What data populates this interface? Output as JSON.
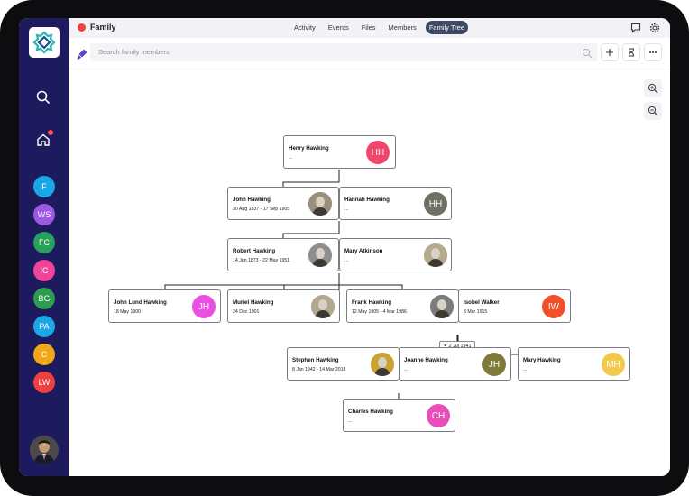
{
  "app": {
    "title": "Family",
    "accent": "#f2423f"
  },
  "nav_tabs": [
    {
      "label": "Activity",
      "active": false
    },
    {
      "label": "Events",
      "active": false
    },
    {
      "label": "Files",
      "active": false
    },
    {
      "label": "Members",
      "active": false
    },
    {
      "label": "Family Tree",
      "active": true
    }
  ],
  "search": {
    "placeholder": "Search family members"
  },
  "rail": {
    "spaces": [
      {
        "label": "F",
        "color": "#1aa7e8"
      },
      {
        "label": "WS",
        "color": "#9b59e6"
      },
      {
        "label": "FC",
        "color": "#27a05c"
      },
      {
        "label": "IC",
        "color": "#f0449b"
      },
      {
        "label": "BG",
        "color": "#2e9c4e"
      },
      {
        "label": "PA",
        "color": "#1aa7e8"
      },
      {
        "label": "C",
        "color": "#f0a818"
      },
      {
        "label": "LW",
        "color": "#ef4040"
      }
    ]
  },
  "tree": {
    "marriage_label": "⚭ 2 Jul 1941",
    "people": {
      "henry": {
        "name": "Henry Hawking",
        "dates": "...",
        "initials": "HH",
        "color": "#f2456b"
      },
      "john": {
        "name": "John Hawking",
        "dates": "30 Aug 1837 - 17 Sep 1905",
        "initials": "",
        "color": "#9a8f7c"
      },
      "hannah": {
        "name": "Hannah Hawking",
        "dates": "...",
        "initials": "HH",
        "color": "#6e7062"
      },
      "robert": {
        "name": "Robert Hawking",
        "dates": "14 Jun 1873 - 22 May 1951",
        "initials": "",
        "color": "#8e8e8e"
      },
      "mary_a": {
        "name": "Mary Atkinson",
        "dates": "...",
        "initials": "",
        "color": "#b5a98e"
      },
      "john_lund": {
        "name": "John Lund Hawking",
        "dates": "18 May 1900",
        "initials": "JH",
        "color": "#e94fe2"
      },
      "muriel": {
        "name": "Muriel Hawking",
        "dates": "24 Dec 1901",
        "initials": "",
        "color": "#b3a78d"
      },
      "frank": {
        "name": "Frank Hawking",
        "dates": "12 May 1905 - 4 Mar 1986",
        "initials": "",
        "color": "#7c7c7c"
      },
      "isobel": {
        "name": "Isobel Walker",
        "dates": "3 Mar 1915",
        "initials": "IW",
        "color": "#f24e2a"
      },
      "stephen": {
        "name": "Stephen Hawking",
        "dates": "8 Jan 1942 - 14 Mar 2018",
        "initials": "",
        "color": "#caa236"
      },
      "joanne": {
        "name": "Joanne Hawking",
        "dates": "...",
        "initials": "JH",
        "color": "#7d7a3a"
      },
      "mary_h": {
        "name": "Mary Hawking",
        "dates": "...",
        "initials": "MH",
        "color": "#f2c94c"
      },
      "charles": {
        "name": "Charles Hawking",
        "dates": "...",
        "initials": "CH",
        "color": "#e94fb8"
      }
    }
  }
}
